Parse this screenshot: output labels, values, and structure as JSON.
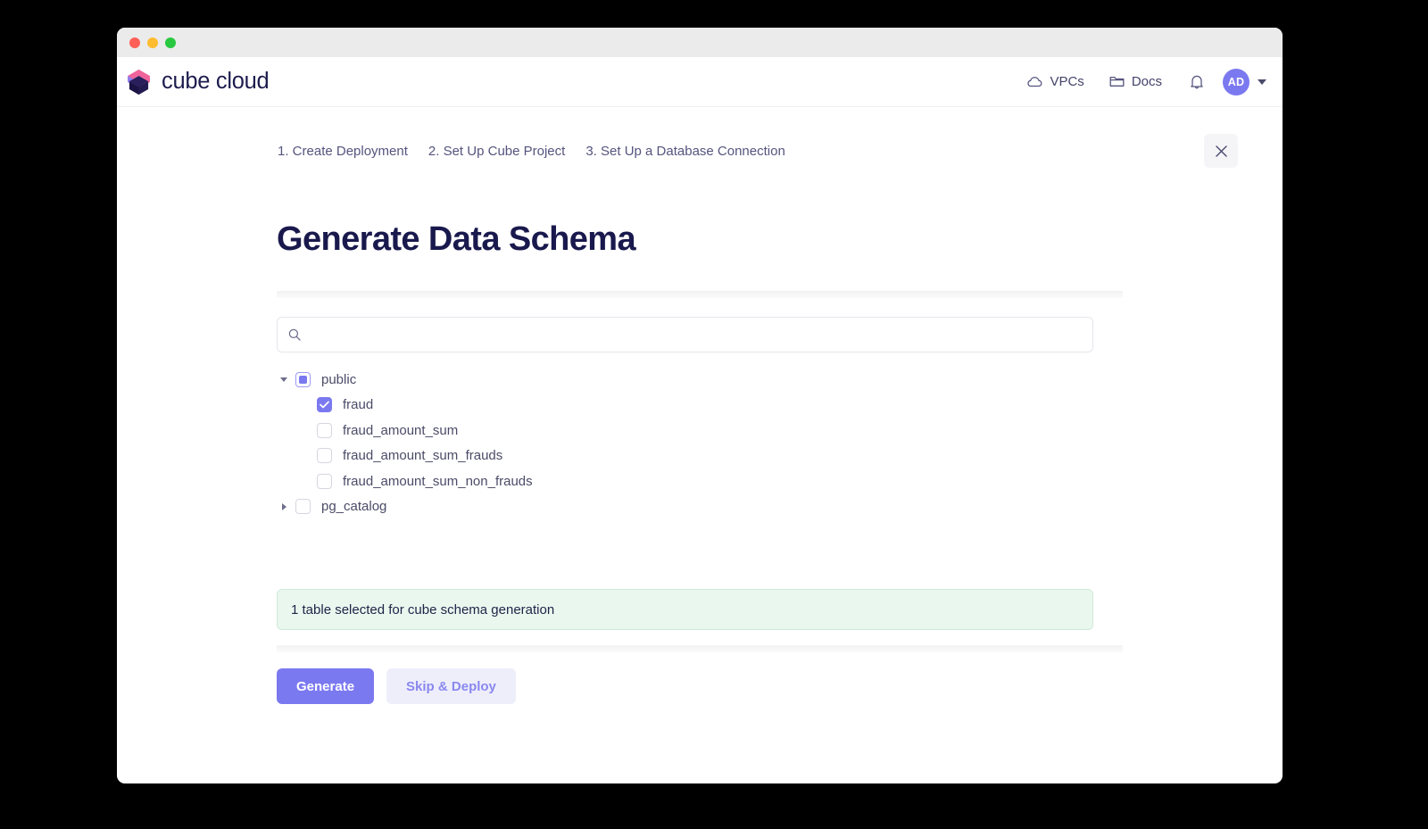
{
  "window": {
    "traffic_lights": [
      "close",
      "minimize",
      "maximize"
    ]
  },
  "nav": {
    "brand": "cube cloud",
    "links": [
      {
        "label": "VPCs",
        "icon": "cloud-icon"
      },
      {
        "label": "Docs",
        "icon": "folder-icon"
      }
    ],
    "bell_icon": "bell-icon",
    "avatar_initials": "AD",
    "caret_icon": "chevron-down-icon"
  },
  "wizard": {
    "steps": [
      "1. Create Deployment",
      "2. Set Up Cube Project",
      "3. Set Up a Database Connection"
    ],
    "close_label": "×"
  },
  "main": {
    "title": "Generate Data Schema",
    "search": {
      "placeholder": "",
      "value": "",
      "icon": "search-icon"
    },
    "tree": [
      {
        "label": "public",
        "level": 0,
        "expanded": true,
        "twisty": "triangle-down",
        "checkbox": "indeterminate"
      },
      {
        "label": "fraud",
        "level": 1,
        "expanded": false,
        "twisty": "none",
        "checkbox": "checked"
      },
      {
        "label": "fraud_amount_sum",
        "level": 1,
        "expanded": false,
        "twisty": "none",
        "checkbox": "unchecked"
      },
      {
        "label": "fraud_amount_sum_frauds",
        "level": 1,
        "expanded": false,
        "twisty": "none",
        "checkbox": "unchecked"
      },
      {
        "label": "fraud_amount_sum_non_frauds",
        "level": 1,
        "expanded": false,
        "twisty": "none",
        "checkbox": "unchecked"
      },
      {
        "label": "pg_catalog",
        "level": 0,
        "expanded": false,
        "twisty": "triangle-right",
        "checkbox": "unchecked"
      }
    ],
    "status_message": "1 table selected for cube schema generation",
    "actions": {
      "primary_label": "Generate",
      "secondary_label": "Skip & Deploy"
    }
  },
  "colors": {
    "accent": "#7b79f0",
    "title": "#19194d",
    "status_bg": "#eaf7ee",
    "status_border": "#cfead8",
    "secondary_btn_bg": "#eeeefb",
    "secondary_btn_text": "#8a88ee",
    "page_bg": "#000000"
  }
}
